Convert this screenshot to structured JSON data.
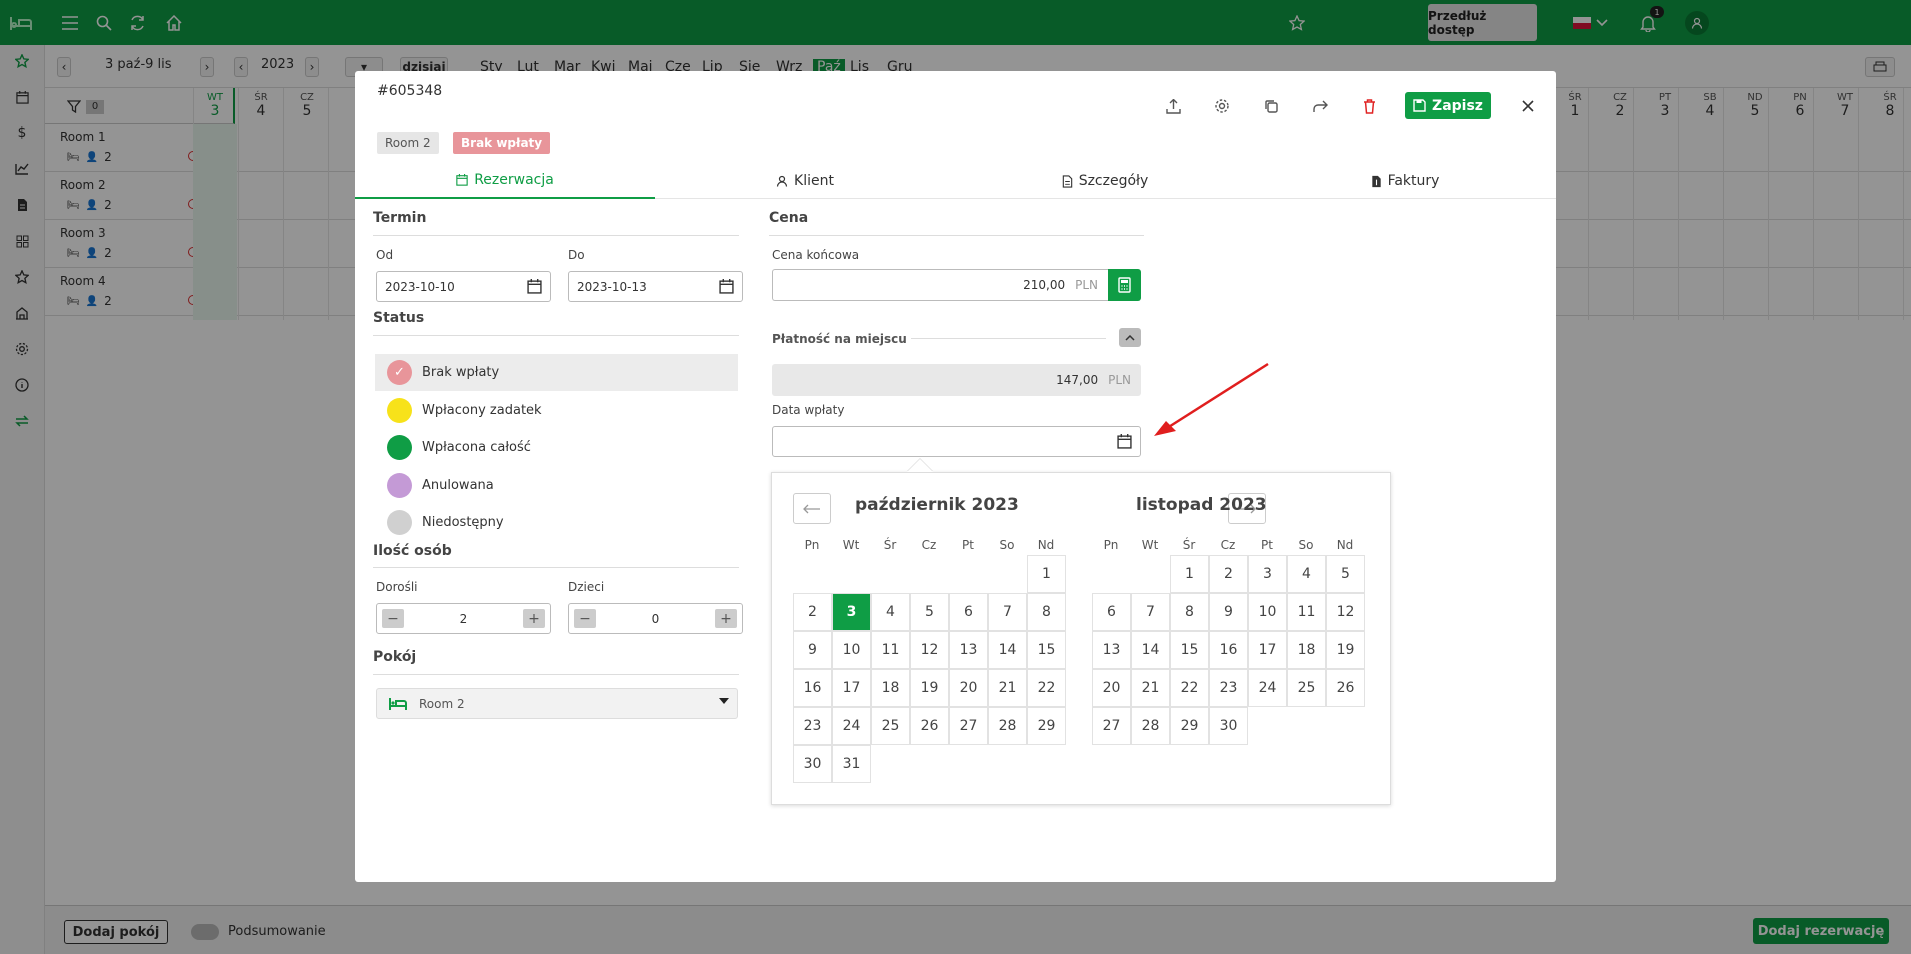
{
  "topbar": {
    "extend_label": "Przedłuż dostęp",
    "notif_count": "1"
  },
  "toolbar": {
    "range": "3 paź-9 lis",
    "year": "2023",
    "today": "dzisiaj",
    "months": [
      "Sty",
      "Lut",
      "Mar",
      "Kwi",
      "Maj",
      "Cze",
      "Lip",
      "Sie",
      "Wrz",
      "Paź",
      "Lis",
      "Gru"
    ],
    "active_month": "Paź"
  },
  "grid": {
    "filter_count": "0",
    "rooms": [
      {
        "name": "Room 1",
        "guests": "2"
      },
      {
        "name": "Room 2",
        "guests": "2"
      },
      {
        "name": "Room 3",
        "guests": "2"
      },
      {
        "name": "Room 4",
        "guests": "2"
      }
    ],
    "days_left": [
      {
        "wd": "WT",
        "d": "3"
      },
      {
        "wd": "ŚR",
        "d": "4"
      },
      {
        "wd": "CZ",
        "d": "5"
      }
    ],
    "days_right": [
      {
        "wd": "ŚR",
        "d": "1"
      },
      {
        "wd": "CZ",
        "d": "2"
      },
      {
        "wd": "PT",
        "d": "3"
      },
      {
        "wd": "SB",
        "d": "4"
      },
      {
        "wd": "ND",
        "d": "5"
      },
      {
        "wd": "PN",
        "d": "6"
      },
      {
        "wd": "WT",
        "d": "7"
      },
      {
        "wd": "ŚR",
        "d": "8"
      }
    ]
  },
  "footer": {
    "add_room": "Dodaj pokój",
    "summary": "Podsumowanie",
    "add_reservation": "Dodaj rezerwację"
  },
  "modal": {
    "title": "#605348",
    "save_label": "Zapisz",
    "badge_room": "Room 2",
    "badge_status": "Brak wpłaty",
    "tabs": [
      "Rezerwacja",
      "Klient",
      "Szczegóły",
      "Faktury"
    ],
    "termin": {
      "title": "Termin",
      "from_label": "Od",
      "from_value": "2023-10-10",
      "to_label": "Do",
      "to_value": "2023-10-13"
    },
    "status": {
      "title": "Status",
      "options": [
        {
          "label": "Brak wpłaty",
          "color": "#e8959a"
        },
        {
          "label": "Wpłacony zadatek",
          "color": "#f7e21a"
        },
        {
          "label": "Wpłacona całość",
          "color": "#0f9d45"
        },
        {
          "label": "Anulowana",
          "color": "#c49ad6"
        },
        {
          "label": "Niedostępny",
          "color": "#d0d0d0"
        }
      ]
    },
    "persons": {
      "title": "Ilość osób",
      "adults_label": "Dorośli",
      "adults": "2",
      "children_label": "Dzieci",
      "children": "0"
    },
    "room": {
      "title": "Pokój",
      "value": "Room 2"
    },
    "price": {
      "title": "Cena",
      "final_label": "Cena końcowa",
      "final_value": "210,00",
      "currency": "PLN",
      "onsite_label": "Płatność na miejscu",
      "onsite_value": "147,00",
      "date_label": "Data wpłaty"
    },
    "datepicker": {
      "weekdays": [
        "Pn",
        "Wt",
        "Śr",
        "Cz",
        "Pt",
        "So",
        "Nd"
      ],
      "months": [
        {
          "title": "październik 2023",
          "offset": 6,
          "days": 31,
          "selected": 3
        },
        {
          "title": "listopad 2023",
          "offset": 2,
          "days": 30,
          "selected": 0
        }
      ]
    }
  }
}
